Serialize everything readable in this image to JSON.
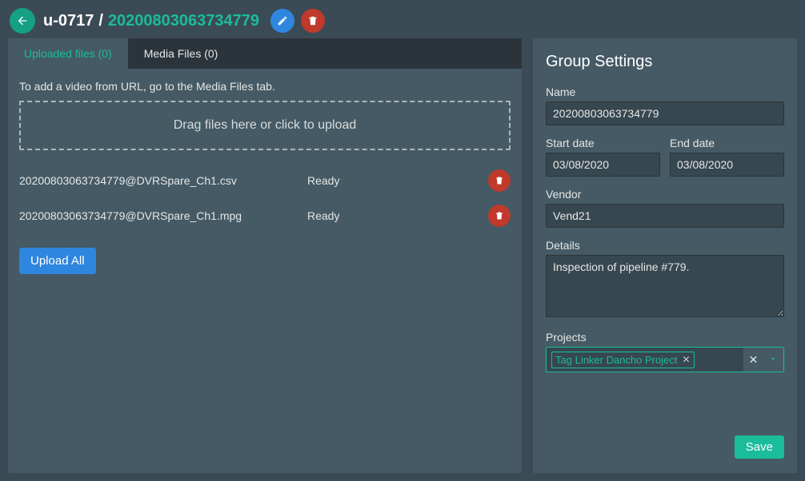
{
  "header": {
    "crumb1": "u-0717",
    "crumb2": "20200803063734779"
  },
  "tabs": {
    "uploaded": "Uploaded files (0)",
    "media": "Media Files (0)"
  },
  "left": {
    "hint": "To add a video from URL, go to the Media Files tab.",
    "dropzone": "Drag files here or click to upload",
    "files": [
      {
        "name": "20200803063734779@DVRSpare_Ch1.csv",
        "status": "Ready"
      },
      {
        "name": "20200803063734779@DVRSpare_Ch1.mpg",
        "status": "Ready"
      }
    ],
    "upload_all": "Upload All"
  },
  "right": {
    "title": "Group Settings",
    "labels": {
      "name": "Name",
      "start_date": "Start date",
      "end_date": "End date",
      "vendor": "Vendor",
      "details": "Details",
      "projects": "Projects"
    },
    "values": {
      "name": "20200803063734779",
      "start_date": "03/08/2020",
      "end_date": "03/08/2020",
      "vendor": "Vend21",
      "details": "Inspection of pipeline #779."
    },
    "project_tag": "Tag Linker Dancho Project",
    "save": "Save"
  }
}
